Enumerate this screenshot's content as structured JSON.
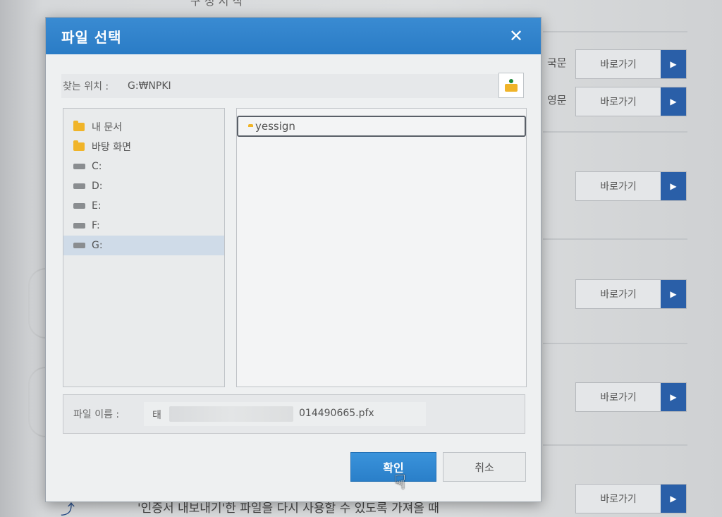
{
  "background": {
    "top_text": "구  청  서  식",
    "labels": {
      "kor": "국문",
      "eng": "영문"
    },
    "shortcut_label": "바로가기",
    "footer_text": "'인증서 내보내기'한 파일을 다시 사용할 수 있도록 가져올 때"
  },
  "dialog": {
    "title": "파일 선택",
    "location_label": "찾는 위치 :",
    "location_value": "G:₩NPKI",
    "tree": [
      {
        "label": "내 문서",
        "type": "folder"
      },
      {
        "label": "바탕 화면",
        "type": "folder"
      },
      {
        "label": "C:",
        "type": "drive"
      },
      {
        "label": "D:",
        "type": "drive"
      },
      {
        "label": "E:",
        "type": "drive"
      },
      {
        "label": "F:",
        "type": "drive"
      },
      {
        "label": "G:",
        "type": "drive",
        "selected": true
      }
    ],
    "files": [
      {
        "label": "yessign",
        "type": "folder"
      }
    ],
    "filename_label": "파일 이름 :",
    "filename_prefix": "태",
    "filename_suffix": "014490665.pfx",
    "ok_label": "확인",
    "cancel_label": "취소"
  },
  "colors": {
    "accent": "#2a7cc6",
    "folder": "#f0b429",
    "shortcut_arrow": "#2a5fa8"
  }
}
